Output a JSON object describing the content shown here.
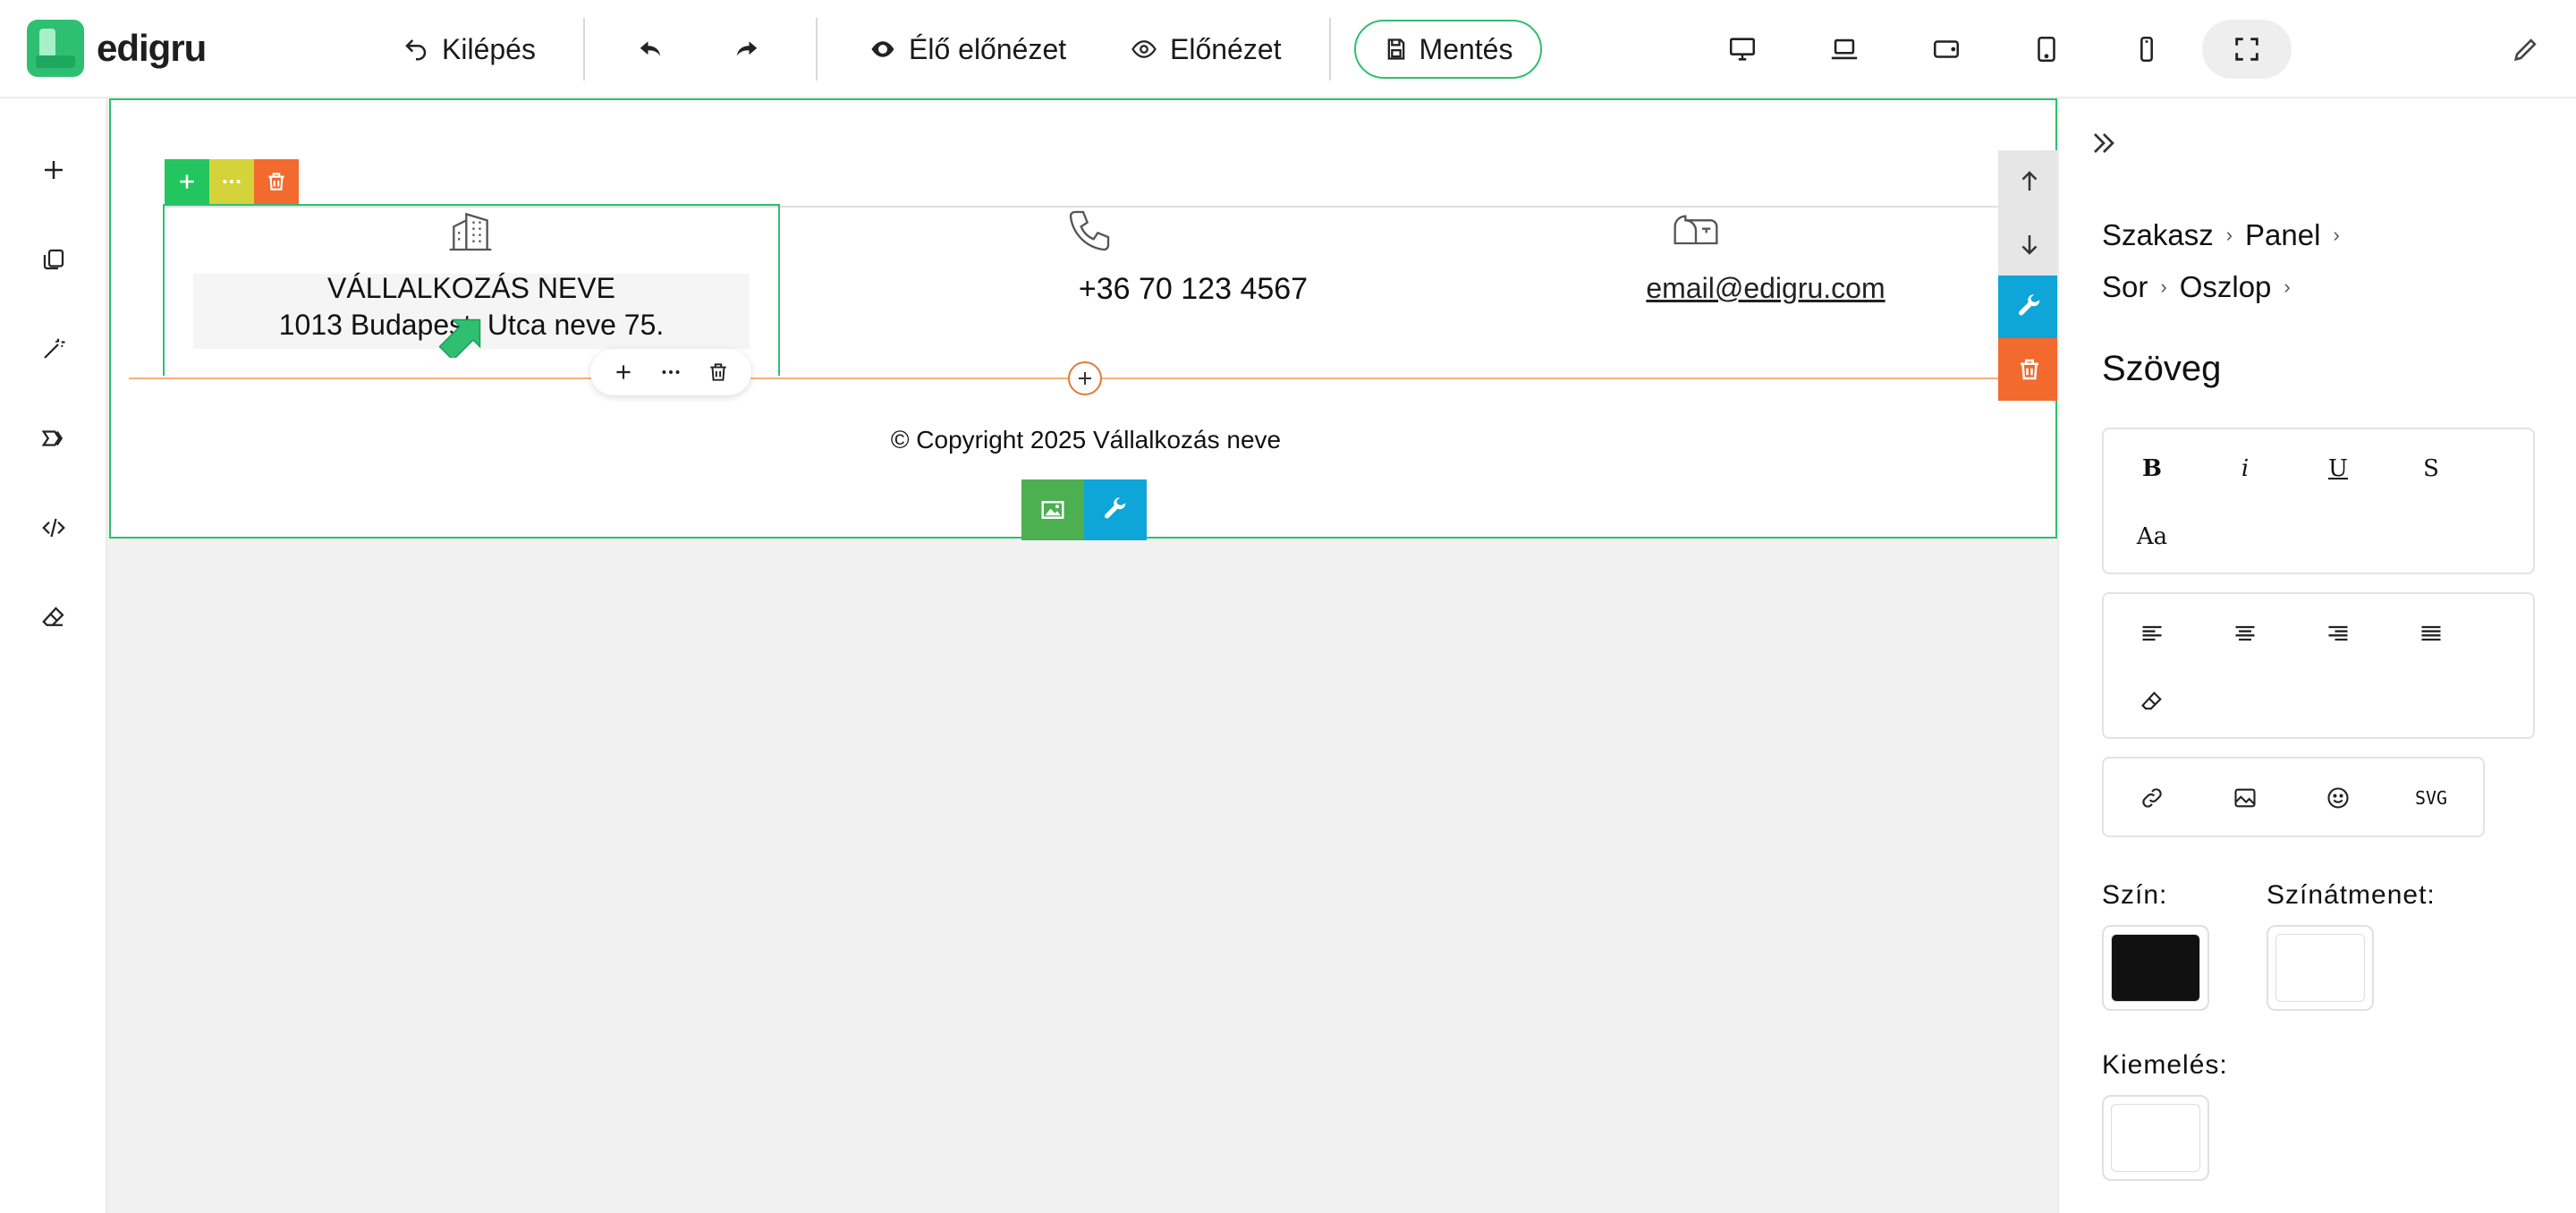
{
  "app": {
    "logo_text": "edigru",
    "brand_color": "#2fbf71"
  },
  "toolbar": {
    "exit_label": "Kilépés",
    "undo_icon": "undo-icon",
    "redo_icon": "redo-icon",
    "live_preview_label": "Élő előnézet",
    "preview_label": "Előnézet",
    "save_label": "Mentés",
    "devices": [
      "desktop-icon",
      "laptop-icon",
      "tablet-landscape-icon",
      "tablet-portrait-icon",
      "mobile-icon",
      "fullscreen-icon"
    ],
    "active_device": "fullscreen-icon",
    "edit_icon": "pencil-icon"
  },
  "leftbar": {
    "items": [
      "add-icon",
      "pages-icon",
      "magic-wand-icon",
      "layers-icon",
      "code-icon",
      "eraser-icon"
    ]
  },
  "canvas": {
    "company_name": "VÁLLALKOZÁS NEVE",
    "address": "1013 Budapest, Utca neve 75.",
    "phone": "+36 70 123 4567",
    "email": "email@edigru.com",
    "copyright": "© Copyright 2025 Vállalkozás neve",
    "colors": {
      "add": "#22c55e",
      "more": "#d4d43a",
      "delete": "#f26a2e",
      "tool": "#0ea5d9",
      "image": "#4caf50",
      "move": "#e6e6e6"
    }
  },
  "panel": {
    "breadcrumb_line1": [
      "Szakasz",
      "Panel"
    ],
    "breadcrumb_line2": [
      "Sor",
      "Oszlop"
    ],
    "title": "Szöveg",
    "format_buttons": [
      "B",
      "i",
      "U",
      "S",
      "Aa"
    ],
    "align_icons": [
      "align-left-icon",
      "align-center-icon",
      "align-right-icon",
      "align-justify-icon",
      "eraser-icon"
    ],
    "insert_icons": [
      "link-icon",
      "image-icon",
      "emoji-icon"
    ],
    "svg_label": "SVG",
    "color_label": "Szín:",
    "gradient_label": "Színátmenet:",
    "highlight_label": "Kiemelés:",
    "color_value": "#111111",
    "gradient_value": "#ffffff",
    "highlight_value": "#ffffff"
  }
}
